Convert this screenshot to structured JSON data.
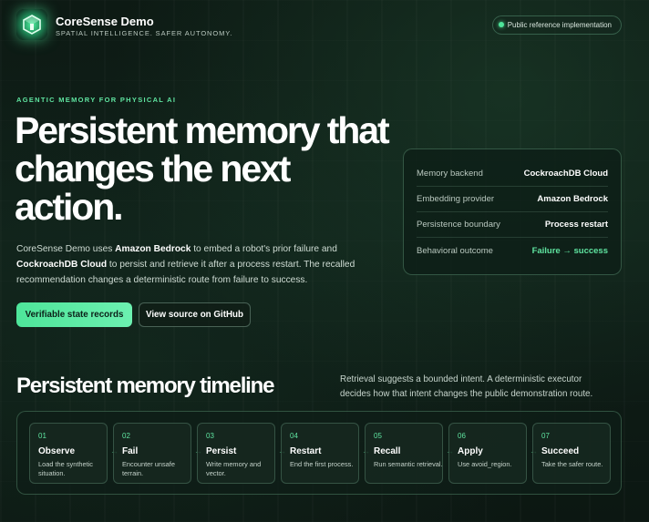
{
  "brand": {
    "name": "CoreSense Demo",
    "tagline": "SPATIAL INTELLIGENCE. SAFER AUTONOMY.",
    "badge": "Public reference implementation"
  },
  "hero": {
    "eyebrow": "AGENTIC MEMORY FOR PHYSICAL AI",
    "headline": "Persistent memory that changes the next action.",
    "lede": {
      "p1": "CoreSense Demo uses ",
      "b1": "Amazon Bedrock",
      "p2": " to embed a robot's prior failure and ",
      "b2": "CockroachDB Cloud",
      "p3": " to persist and retrieve it after a process restart. The recalled recommendation changes a deterministic route from failure to success."
    },
    "primary_button": "Verifiable state records",
    "secondary_button": "View source on GitHub"
  },
  "info_card": [
    {
      "label": "Memory backend",
      "value": "CockroachDB Cloud"
    },
    {
      "label": "Embedding provider",
      "value": "Amazon Bedrock"
    },
    {
      "label": "Persistence boundary",
      "value": "Process restart"
    },
    {
      "label": "Behavioral outcome",
      "value": "Failure → success"
    }
  ],
  "timeline": {
    "title": "Persistent memory timeline",
    "description": "Retrieval suggests a bounded intent. A deterministic executor decides how that intent changes the public demonstration route.",
    "arrow": "→",
    "steps": [
      {
        "num": "01",
        "title": "Observe",
        "desc": "Load the synthetic situation."
      },
      {
        "num": "02",
        "title": "Fail",
        "desc": "Encounter unsafe terrain."
      },
      {
        "num": "03",
        "title": "Persist",
        "desc": "Write memory and vector."
      },
      {
        "num": "04",
        "title": "Restart",
        "desc": "End the first process."
      },
      {
        "num": "05",
        "title": "Recall",
        "desc": "Run semantic retrieval."
      },
      {
        "num": "06",
        "title": "Apply",
        "desc": "Use avoid_region."
      },
      {
        "num": "07",
        "title": "Succeed",
        "desc": "Take the safer route."
      }
    ]
  },
  "colors": {
    "accent": "#4ee59a",
    "background": "#0d1a14"
  }
}
